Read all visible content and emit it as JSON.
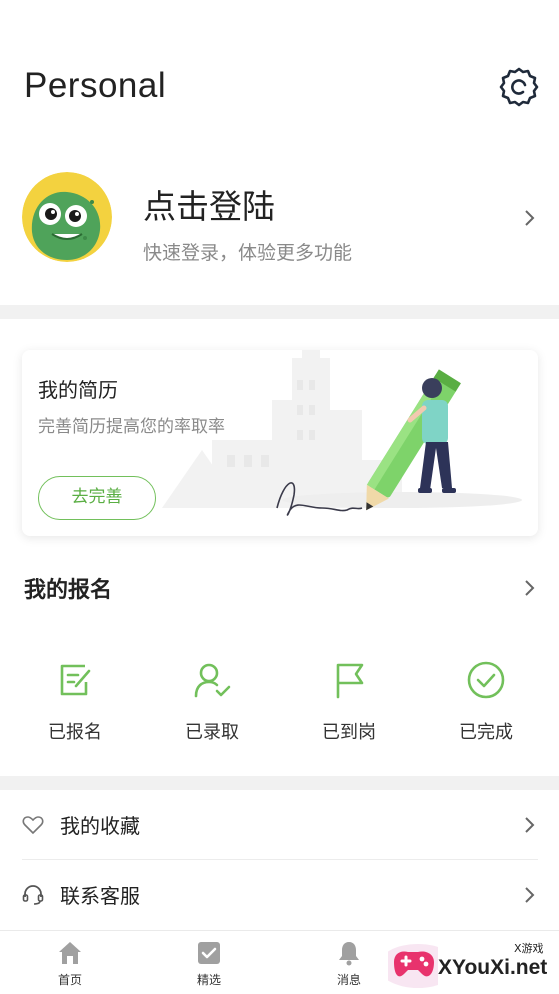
{
  "header": {
    "title": "Personal"
  },
  "login": {
    "title": "点击登陆",
    "subtitle": "快速登录，体验更多功能"
  },
  "resume": {
    "title": "我的简历",
    "subtitle": "完善简历提高您的率取率",
    "button": "去完善"
  },
  "registration": {
    "title": "我的报名",
    "statuses": [
      {
        "label": "已报名",
        "icon": "edit-form-icon"
      },
      {
        "label": "已录取",
        "icon": "user-check-icon"
      },
      {
        "label": "已到岗",
        "icon": "flag-icon"
      },
      {
        "label": "已完成",
        "icon": "check-circle-icon"
      }
    ]
  },
  "menu": [
    {
      "label": "我的收藏",
      "icon": "heart-icon"
    },
    {
      "label": "联系客服",
      "icon": "headset-icon"
    }
  ],
  "tabbar": [
    {
      "label": "首页",
      "icon": "home-icon"
    },
    {
      "label": "精选",
      "icon": "featured-icon"
    },
    {
      "label": "消息",
      "icon": "bell-icon"
    }
  ],
  "watermark": {
    "brand": "XYouXi.net",
    "sub": "X游戏"
  },
  "colors": {
    "accent": "#72c05b",
    "icon_gray": "#9a9a9a",
    "separator": "#f1f1f1"
  }
}
